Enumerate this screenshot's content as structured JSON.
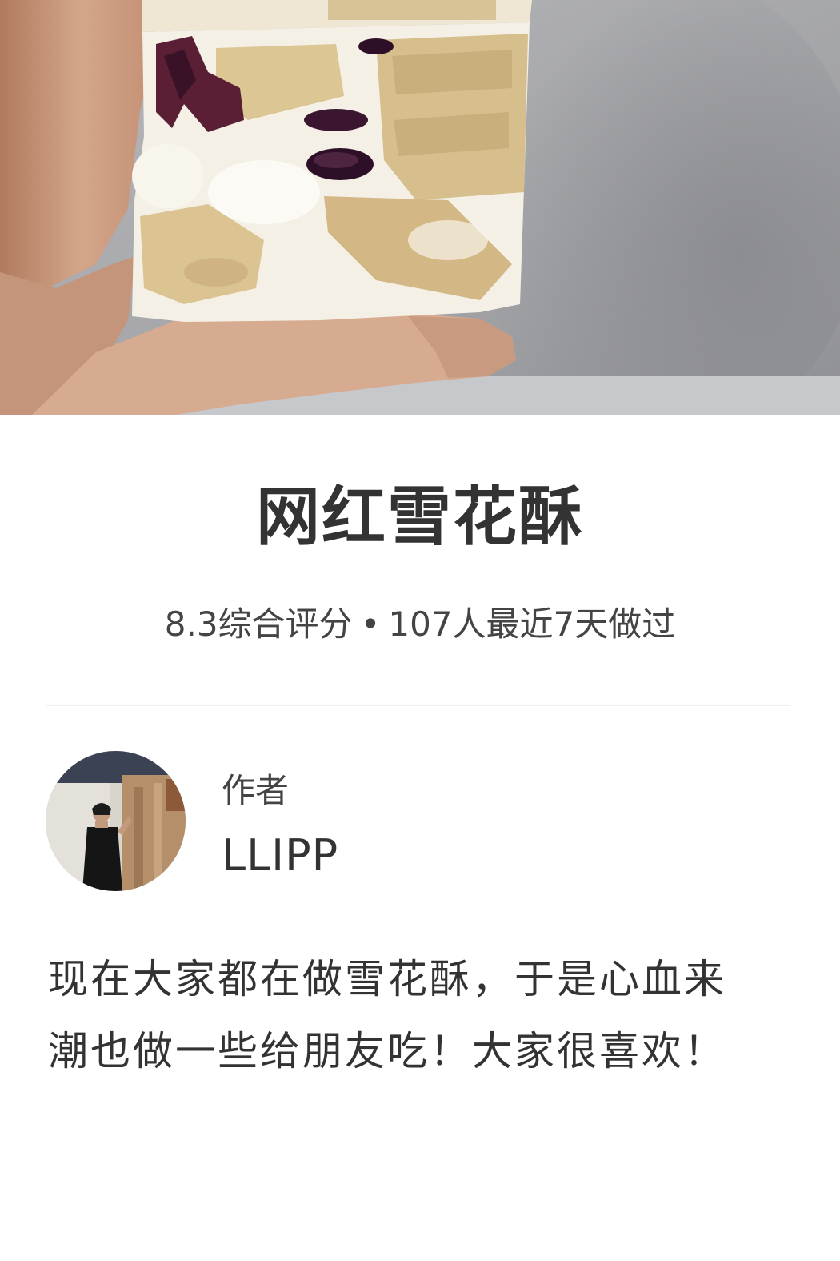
{
  "hero": {
    "image": "snowflake-pastry-photo"
  },
  "recipe": {
    "title": "网红雪花酥",
    "rating": "8.3综合评分",
    "separator": "•",
    "cooked_recently": "107人最近7天做过"
  },
  "author": {
    "caption": "作者",
    "name": "LLIPP",
    "avatar": "author-avatar-photo"
  },
  "description": {
    "line1": "现在大家都在做雪花酥，于是心血来",
    "line2": "潮也做一些给朋友吃！大家很喜欢！"
  },
  "colors": {
    "text_primary": "#333333",
    "text_secondary": "#444444",
    "divider": "#efefef",
    "background": "#ffffff"
  }
}
